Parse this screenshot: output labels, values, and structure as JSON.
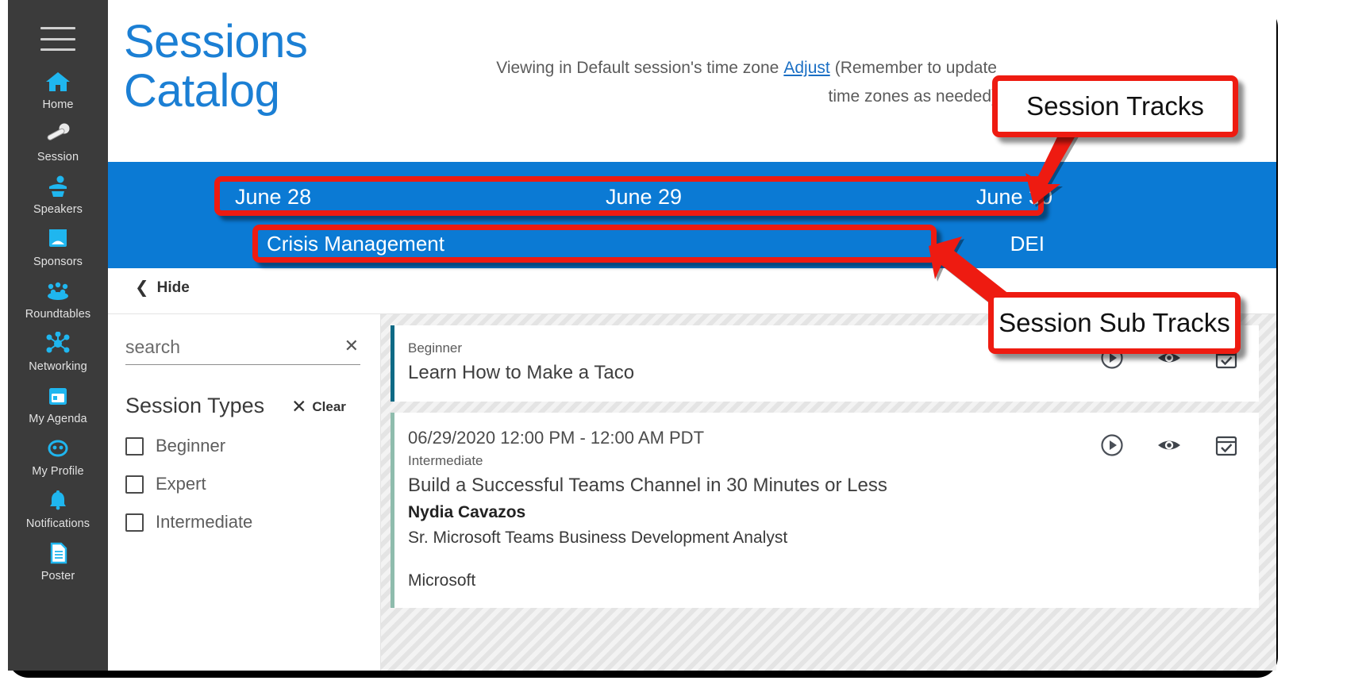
{
  "nav": {
    "menu_icon": "hamburger-icon",
    "items": [
      {
        "label": "Home",
        "icon": "home-icon"
      },
      {
        "label": "Session",
        "icon": "microphone-icon"
      },
      {
        "label": "Speakers",
        "icon": "speaker-podium-icon"
      },
      {
        "label": "Sponsors",
        "icon": "sponsors-booth-icon"
      },
      {
        "label": "Roundtables",
        "icon": "roundtable-group-icon"
      },
      {
        "label": "Networking",
        "icon": "networking-nodes-icon"
      },
      {
        "label": "My Agenda",
        "icon": "calendar-icon"
      },
      {
        "label": "My Profile",
        "icon": "profile-face-icon"
      },
      {
        "label": "Notifications",
        "icon": "bell-icon"
      },
      {
        "label": "Poster",
        "icon": "document-icon"
      }
    ]
  },
  "header": {
    "title": "Sessions Catalog",
    "timezone_notice_part1": "Viewing in Default session's time zone",
    "timezone_adjust_link": "Adjust",
    "timezone_notice_part2": "(Remember to update time zones as needed)"
  },
  "tracks": {
    "items": [
      {
        "label": "June 28"
      },
      {
        "label": "June 29"
      },
      {
        "label": "June 30"
      }
    ]
  },
  "subtracks": {
    "items": [
      {
        "label": "Crisis Management"
      },
      {
        "label": "DEI"
      }
    ]
  },
  "hide_bar": {
    "label": "Hide",
    "chevron": "chevron-left-icon"
  },
  "filters": {
    "search_placeholder": "search",
    "search_value": "",
    "clear_search_icon": "close-icon",
    "section_title": "Session Types",
    "clear_label": "Clear",
    "clear_icon": "close-icon",
    "options": [
      {
        "label": "Beginner",
        "checked": false
      },
      {
        "label": "Expert",
        "checked": false
      },
      {
        "label": "Intermediate",
        "checked": false
      }
    ]
  },
  "sessions": {
    "action_icons": [
      "play-circle-icon",
      "eye-icon",
      "calendar-check-icon"
    ],
    "cards": [
      {
        "accent": "teal",
        "time": "",
        "level": "Beginner",
        "title": "Learn How to Make a Taco",
        "speaker": "",
        "role": "",
        "org": ""
      },
      {
        "accent": "sage",
        "time": "06/29/2020 12:00 PM - 12:00 AM PDT",
        "level": "Intermediate",
        "title": "Build a Successful Teams Channel in 30 Minutes or Less",
        "speaker": "Nydia Cavazos",
        "role": "Sr. Microsoft Teams Business Development Analyst",
        "org": "Microsoft"
      }
    ]
  },
  "annotations": {
    "callout_tracks": "Session Tracks",
    "callout_subtracks": "Session Sub Tracks",
    "highlight_color": "#ee1b11"
  },
  "colors": {
    "brand_blue": "#0b7ad4",
    "title_blue": "#1b7fd4",
    "nav_dark": "#3b3b3b",
    "nav_icon_cyan": "#1fb6ef",
    "annotation_red": "#ee1b11",
    "accent_teal": "#0f6a85",
    "accent_sage": "#8fbcad"
  }
}
